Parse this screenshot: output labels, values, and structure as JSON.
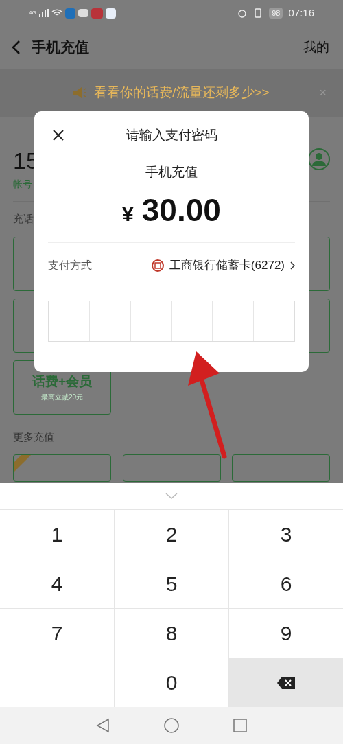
{
  "status_bar": {
    "time": "07:16",
    "battery": "98",
    "network": "4G"
  },
  "header": {
    "title": "手机充值",
    "action": "我的"
  },
  "banner": {
    "text": "看看你的话费/流量还剩多少>>",
    "close": "×"
  },
  "account": {
    "number": "15",
    "label": "帐号"
  },
  "section_label": "充话",
  "package_cards": [
    {
      "title": "话费+会员",
      "subtitle": "最高立减20元"
    }
  ],
  "more_label": "更多充值",
  "dialog": {
    "title": "请输入支付密码",
    "item": "手机充值",
    "amount": "30.00",
    "currency": "¥",
    "payment_label": "支付方式",
    "payment_method": "工商银行储蓄卡(6272)"
  },
  "keypad": {
    "keys": [
      {
        "kind": "digit",
        "label": "1"
      },
      {
        "kind": "digit",
        "label": "2"
      },
      {
        "kind": "digit",
        "label": "3"
      },
      {
        "kind": "digit",
        "label": "4"
      },
      {
        "kind": "digit",
        "label": "5"
      },
      {
        "kind": "digit",
        "label": "6"
      },
      {
        "kind": "digit",
        "label": "7"
      },
      {
        "kind": "digit",
        "label": "8"
      },
      {
        "kind": "digit",
        "label": "9"
      },
      {
        "kind": "blank"
      },
      {
        "kind": "digit",
        "label": "0"
      },
      {
        "kind": "backspace"
      }
    ]
  }
}
